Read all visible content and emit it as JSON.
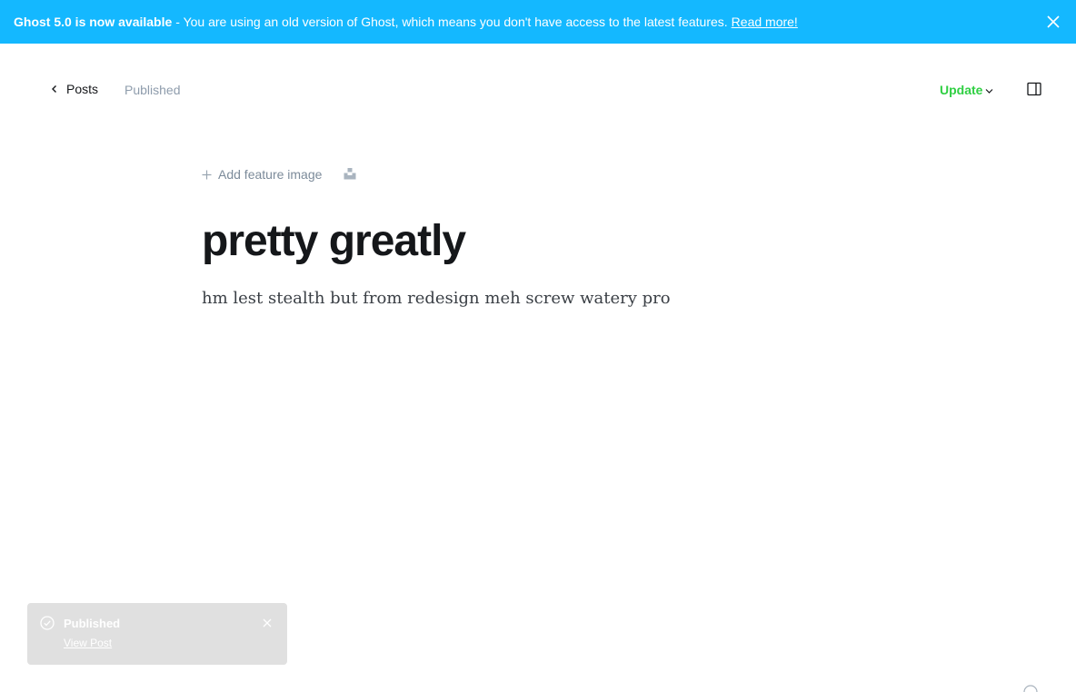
{
  "banner": {
    "strong": "Ghost 5.0 is now available",
    "message": "- You are using an old version of Ghost, which means you don't have access to the latest features.",
    "link": "Read more!",
    "bg_color": "#14b8ff"
  },
  "header": {
    "back_label": "Posts",
    "status": "Published",
    "update_label": "Update",
    "update_color": "#30cf43"
  },
  "editor": {
    "feature_image_label": "Add feature image",
    "title": "pretty greatly",
    "body": "hm lest stealth but from redesign meh screw watery pro"
  },
  "toast": {
    "title": "Published",
    "link": "View Post"
  },
  "icons": {
    "back": "chevron-left-icon",
    "close": "close-icon",
    "update_caret": "chevron-down-icon",
    "sidebar": "sidebar-toggle-icon",
    "add": "plus-icon",
    "unsplash": "unsplash-icon",
    "check": "check-circle-icon",
    "help": "help-icon"
  }
}
